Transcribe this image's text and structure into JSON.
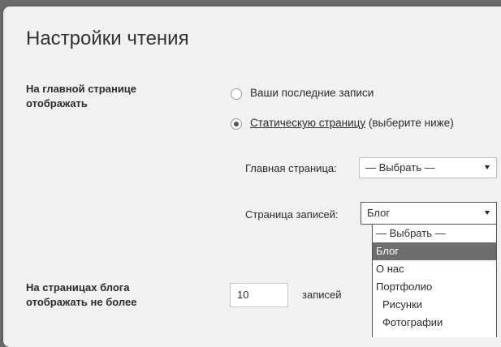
{
  "page": {
    "title": "Настройки чтения"
  },
  "front_page": {
    "label_line1": "На главной странице",
    "label_line2": "отображать",
    "option_latest": "Ваши последние записи",
    "option_static_link": "Статическую страницу",
    "option_static_note": " (выберите ниже)",
    "selected": "static",
    "homepage_label": "Главная страница:",
    "homepage_value": "— Выбрать —",
    "posts_page_label": "Страница записей:",
    "posts_page_value": "Блог",
    "posts_page_options": [
      {
        "label": "— Выбрать —",
        "selected": false,
        "indent": false
      },
      {
        "label": "Блог",
        "selected": true,
        "indent": false
      },
      {
        "label": "О нас",
        "selected": false,
        "indent": false
      },
      {
        "label": "Портфолио",
        "selected": false,
        "indent": false
      },
      {
        "label": "Рисунки",
        "selected": false,
        "indent": true
      },
      {
        "label": "Фотографии",
        "selected": false,
        "indent": true
      }
    ]
  },
  "blog_pages": {
    "label_line1": "На страницах блога",
    "label_line2": "отображать не более",
    "value": "10",
    "suffix": "записей"
  }
}
